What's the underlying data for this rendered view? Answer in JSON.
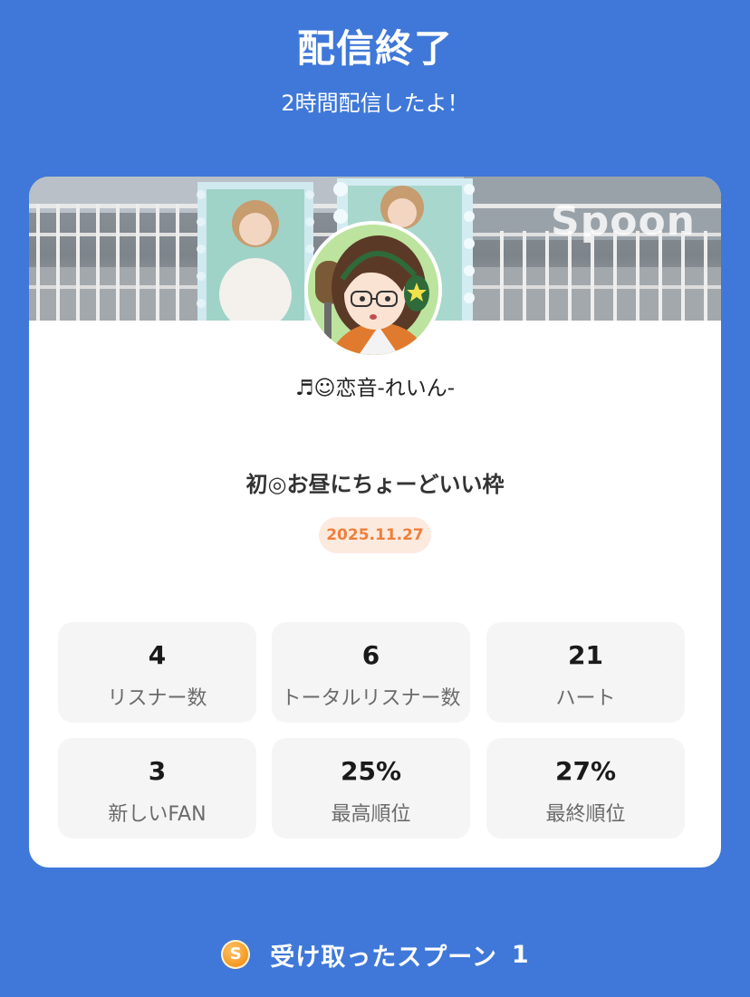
{
  "header": {
    "title": "配信終了",
    "subtitle": "2時間配信したよ！"
  },
  "banner": {
    "logo_text": "Spoon"
  },
  "profile": {
    "username": "♬☺︎恋音-れいん-"
  },
  "broadcast": {
    "title": "初◎お昼にちょーどいい枠",
    "date": "2025.11.27"
  },
  "stats": [
    {
      "value": "4",
      "label": "リスナー数"
    },
    {
      "value": "6",
      "label": "トータルリスナー数"
    },
    {
      "value": "21",
      "label": "ハート"
    },
    {
      "value": "3",
      "label": "新しいFAN"
    },
    {
      "value": "25%",
      "label": "最高順位"
    },
    {
      "value": "27%",
      "label": "最終順位"
    }
  ],
  "footer": {
    "coin_icon": "S",
    "label": "受け取ったスプーン",
    "count": "1"
  },
  "colors": {
    "background": "#3f78d8",
    "card": "#ffffff",
    "stat_box": "#f5f5f5",
    "date_text": "#ef7f3a",
    "date_bg": "#fdeadf",
    "coin": "#f59a23"
  }
}
